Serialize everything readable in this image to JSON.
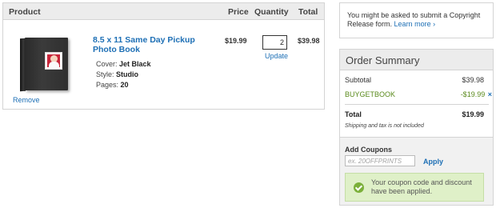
{
  "cart": {
    "headers": {
      "product": "Product",
      "price": "Price",
      "quantity": "Quantity",
      "total": "Total"
    },
    "item": {
      "title": "8.5 x 11 Same Day Pickup Photo Book",
      "options": [
        {
          "label": "Cover:",
          "value": "Jet Black"
        },
        {
          "label": "Style:",
          "value": "Studio"
        },
        {
          "label": "Pages:",
          "value": "20"
        }
      ],
      "price": "$19.99",
      "quantity": "2",
      "update_label": "Update",
      "total": "$39.98",
      "remove_label": "Remove"
    }
  },
  "notice": {
    "text": "You might be asked to submit a Copyright Release form.",
    "link": "Learn more ›"
  },
  "order_summary": {
    "title": "Order Summary",
    "subtotal_label": "Subtotal",
    "subtotal_value": "$39.98",
    "coupon_code": "BUYGETBOOK",
    "coupon_discount": "-$19.99",
    "remove_coupon_glyph": "×",
    "total_label": "Total",
    "total_value": "$19.99",
    "shipping_note": "Shipping and tax is not included",
    "add_coupons_label": "Add Coupons",
    "coupon_placeholder": "ex. 20OFFPRINTS",
    "apply_label": "Apply",
    "success_message": "Your coupon code and discount have been applied."
  },
  "colors": {
    "link": "#1d6fb5",
    "discount": "#5a8a1c",
    "success_bg": "#dff0c8",
    "header_bg": "#ececec"
  },
  "icons": [
    "photo-book-thumbnail",
    "remove-coupon-icon",
    "checkmark-icon"
  ]
}
